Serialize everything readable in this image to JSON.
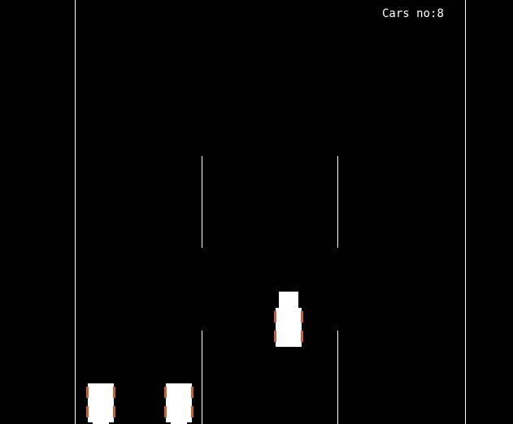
{
  "hud": {
    "cars_label": "Cars no:",
    "cars_count": "8"
  },
  "colors": {
    "background": "#000000",
    "road_lines": "#ffffff",
    "car_body": "#ffffff",
    "car_wheels": "#c1603a"
  },
  "cars": [
    {
      "lane": 3,
      "kind": "player"
    },
    {
      "lane": 1,
      "kind": "traffic"
    },
    {
      "lane": 2,
      "kind": "traffic"
    }
  ]
}
